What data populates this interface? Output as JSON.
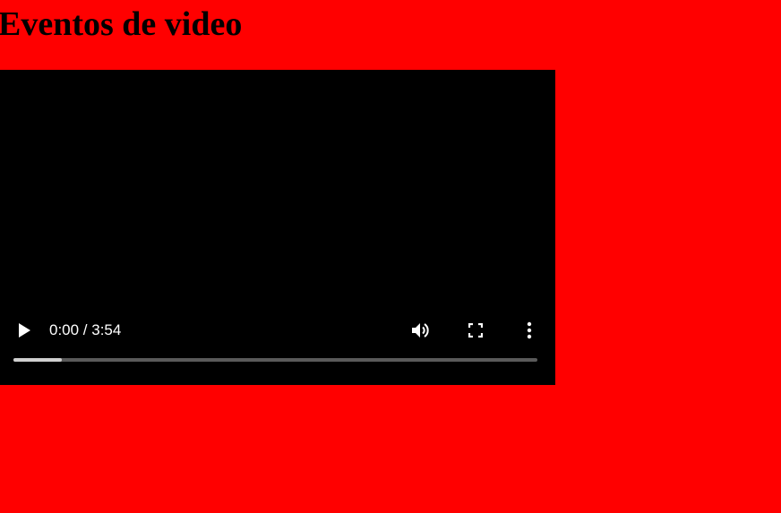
{
  "page": {
    "title": "Eventos de video",
    "background_color": "#ff0000"
  },
  "video": {
    "background_color": "#000000",
    "current_time": "0:00",
    "duration": "3:54",
    "time_display": "0:00 / 3:54",
    "buffered_fraction": 0.092,
    "played_fraction": 0,
    "controls": {
      "play_icon": "play-icon",
      "volume_icon": "volume-icon",
      "fullscreen_icon": "fullscreen-icon",
      "more_icon": "more-options-icon"
    }
  }
}
